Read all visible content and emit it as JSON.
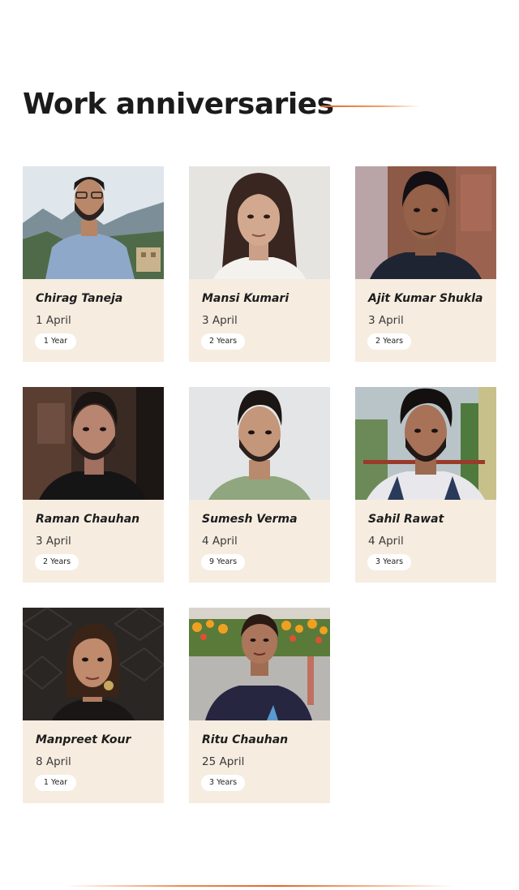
{
  "section": {
    "title": "Work anniversaries"
  },
  "colors": {
    "card_background": "#f6ece0",
    "accent_line": "#e0662b",
    "badge_background": "#ffffff"
  },
  "employees": [
    {
      "name": "Chirag Taneja",
      "date": "1 April",
      "tenure": "1 Year"
    },
    {
      "name": "Mansi Kumari",
      "date": "3 April",
      "tenure": "2 Years"
    },
    {
      "name": "Ajit Kumar Shukla",
      "date": "3 April",
      "tenure": "2 Years"
    },
    {
      "name": "Raman Chauhan",
      "date": "3 April",
      "tenure": "2 Years"
    },
    {
      "name": "Sumesh Verma",
      "date": "4 April",
      "tenure": "9 Years"
    },
    {
      "name": "Sahil Rawat",
      "date": "4 April",
      "tenure": "3 Years"
    },
    {
      "name": "Manpreet Kour",
      "date": "8 April",
      "tenure": "1 Year"
    },
    {
      "name": "Ritu Chauhan",
      "date": "25 April",
      "tenure": "3 Years"
    }
  ]
}
